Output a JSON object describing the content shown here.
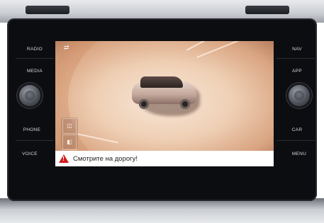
{
  "left_buttons": [
    "RADIO",
    "MEDIA",
    "PHONE",
    "VOICE"
  ],
  "right_buttons": [
    "NAV",
    "APP",
    "CAR",
    "MENU"
  ],
  "warning": {
    "text": "Смотрите на дорогу!",
    "icon": "warning-triangle-icon"
  },
  "camera_view": {
    "mode": "area-view-top",
    "icons": [
      "camera-view-icon",
      "camera-switch-icon"
    ]
  }
}
